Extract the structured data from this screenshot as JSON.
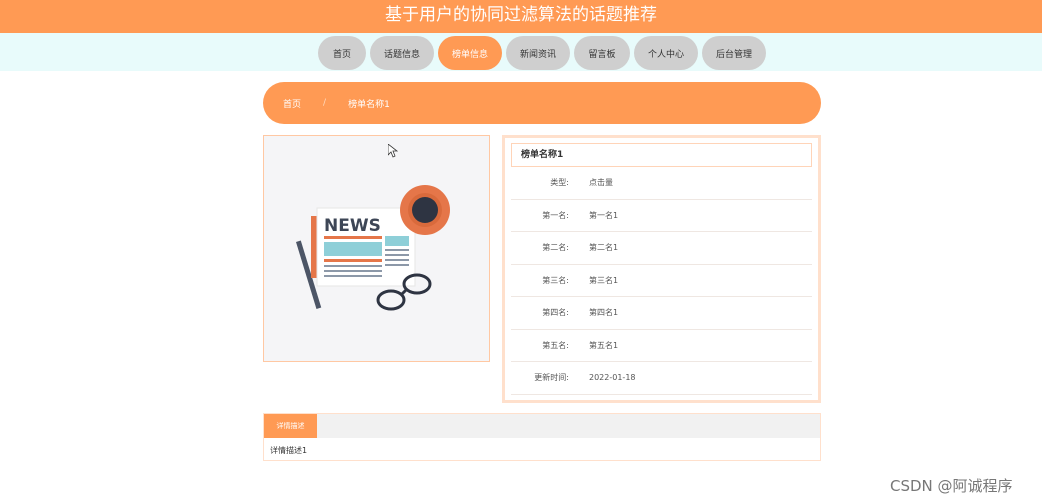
{
  "header": {
    "title": "基于用户的协同过滤算法的话题推荐"
  },
  "nav": [
    {
      "label": "首页",
      "width": 48
    },
    {
      "label": "话题信息",
      "width": 64
    },
    {
      "label": "榜单信息",
      "width": 64,
      "active": true
    },
    {
      "label": "新闻资讯",
      "width": 64
    },
    {
      "label": "留言板",
      "width": 56
    },
    {
      "label": "个人中心",
      "width": 64
    },
    {
      "label": "后台管理",
      "width": 64
    }
  ],
  "breadcrumb": {
    "home": "首页",
    "separator": "/",
    "current": "榜单名称1"
  },
  "detail": {
    "title": "榜单名称1",
    "rows": [
      {
        "label": "类型:",
        "value": "点击量"
      },
      {
        "label": "第一名:",
        "value": "第一名1"
      },
      {
        "label": "第二名:",
        "value": "第二名1"
      },
      {
        "label": "第三名:",
        "value": "第三名1"
      },
      {
        "label": "第四名:",
        "value": "第四名1"
      },
      {
        "label": "第五名:",
        "value": "第五名1"
      },
      {
        "label": "更新时间:",
        "value": "2022-01-18"
      }
    ]
  },
  "image": {
    "text": "NEWS"
  },
  "tabs": {
    "active_label": "详情描述",
    "content": "详情描述1"
  },
  "watermark": "CSDN @阿诚程序",
  "colors": {
    "accent": "#ff9a54",
    "nav_band": "#e8fbfb",
    "nav_inactive": "#cfcfcf"
  }
}
